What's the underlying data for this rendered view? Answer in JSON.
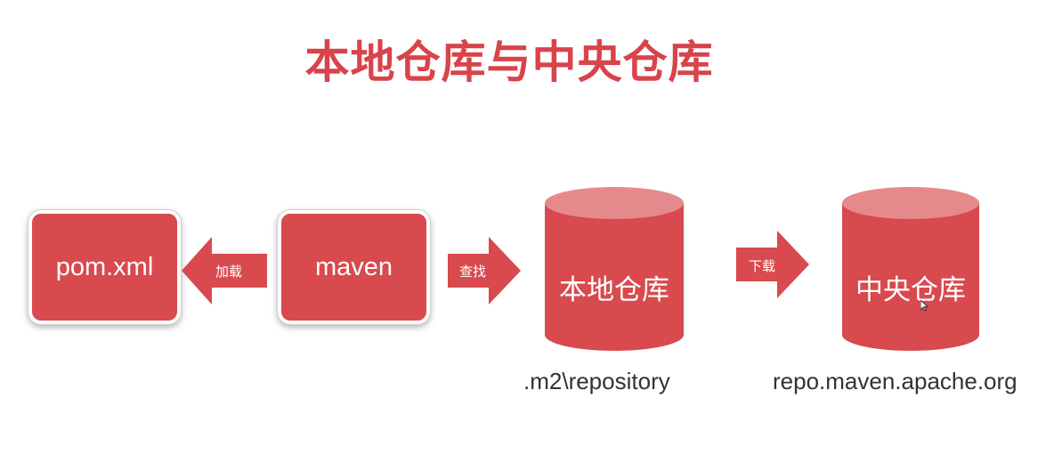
{
  "title": "本地仓库与中央仓库",
  "colors": {
    "primary_red": "#d84a4e",
    "cylinder_top": "#e58a8c",
    "title_red": "#d9434a"
  },
  "nodes": {
    "pom": "pom.xml",
    "maven": "maven",
    "local_repo": "本地仓库",
    "central_repo": "中央仓库"
  },
  "arrows": {
    "load": "加载",
    "find": "查找",
    "download": "下载"
  },
  "captions": {
    "local_path": ".m2\\repository",
    "central_url": "repo.maven.apache.org"
  }
}
